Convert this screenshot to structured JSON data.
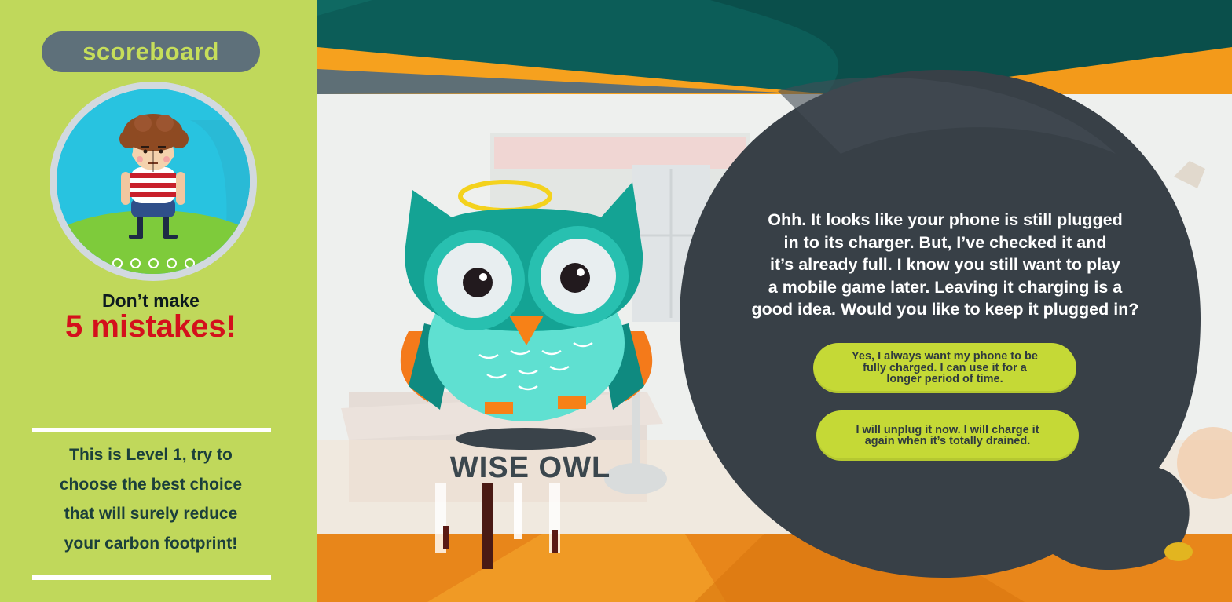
{
  "scoreboard": {
    "title": "scoreboard",
    "lives": [
      1,
      2,
      3,
      4,
      5
    ],
    "warning_line1": "Don’t make",
    "warning_line2": "5 mistakes!",
    "level_line1": "This is Level 1, try to",
    "level_line2": "choose the best choice",
    "level_line3": "that will surely reduce",
    "level_line4": "your carbon footprint!"
  },
  "character": {
    "name": "WISE OWL"
  },
  "dialog": {
    "line1": "Ohh. It looks like your phone is still plugged",
    "line2": "in to its charger. But, I’ve checked it and",
    "line3": "it’s already full. I know you still want to play",
    "line4": "a mobile game later. Leaving it charging is a",
    "line5": "good idea. Would you like to keep it plugged in?",
    "choices": [
      {
        "line1": "Yes, I always want my phone to be",
        "line2": "fully charged. I can use it for a",
        "line3": "longer period of time."
      },
      {
        "line1": "I will unplug it now. I will charge it",
        "line2": "again when it’s totally drained."
      }
    ]
  },
  "colors": {
    "sidebar_bg": "#c0d85b",
    "accent_green": "#c5d936",
    "warning_red": "#d4101c",
    "bubble_dark": "#384047",
    "owl_teal": "#1aa596",
    "wall_orange": "#f39a1a"
  }
}
